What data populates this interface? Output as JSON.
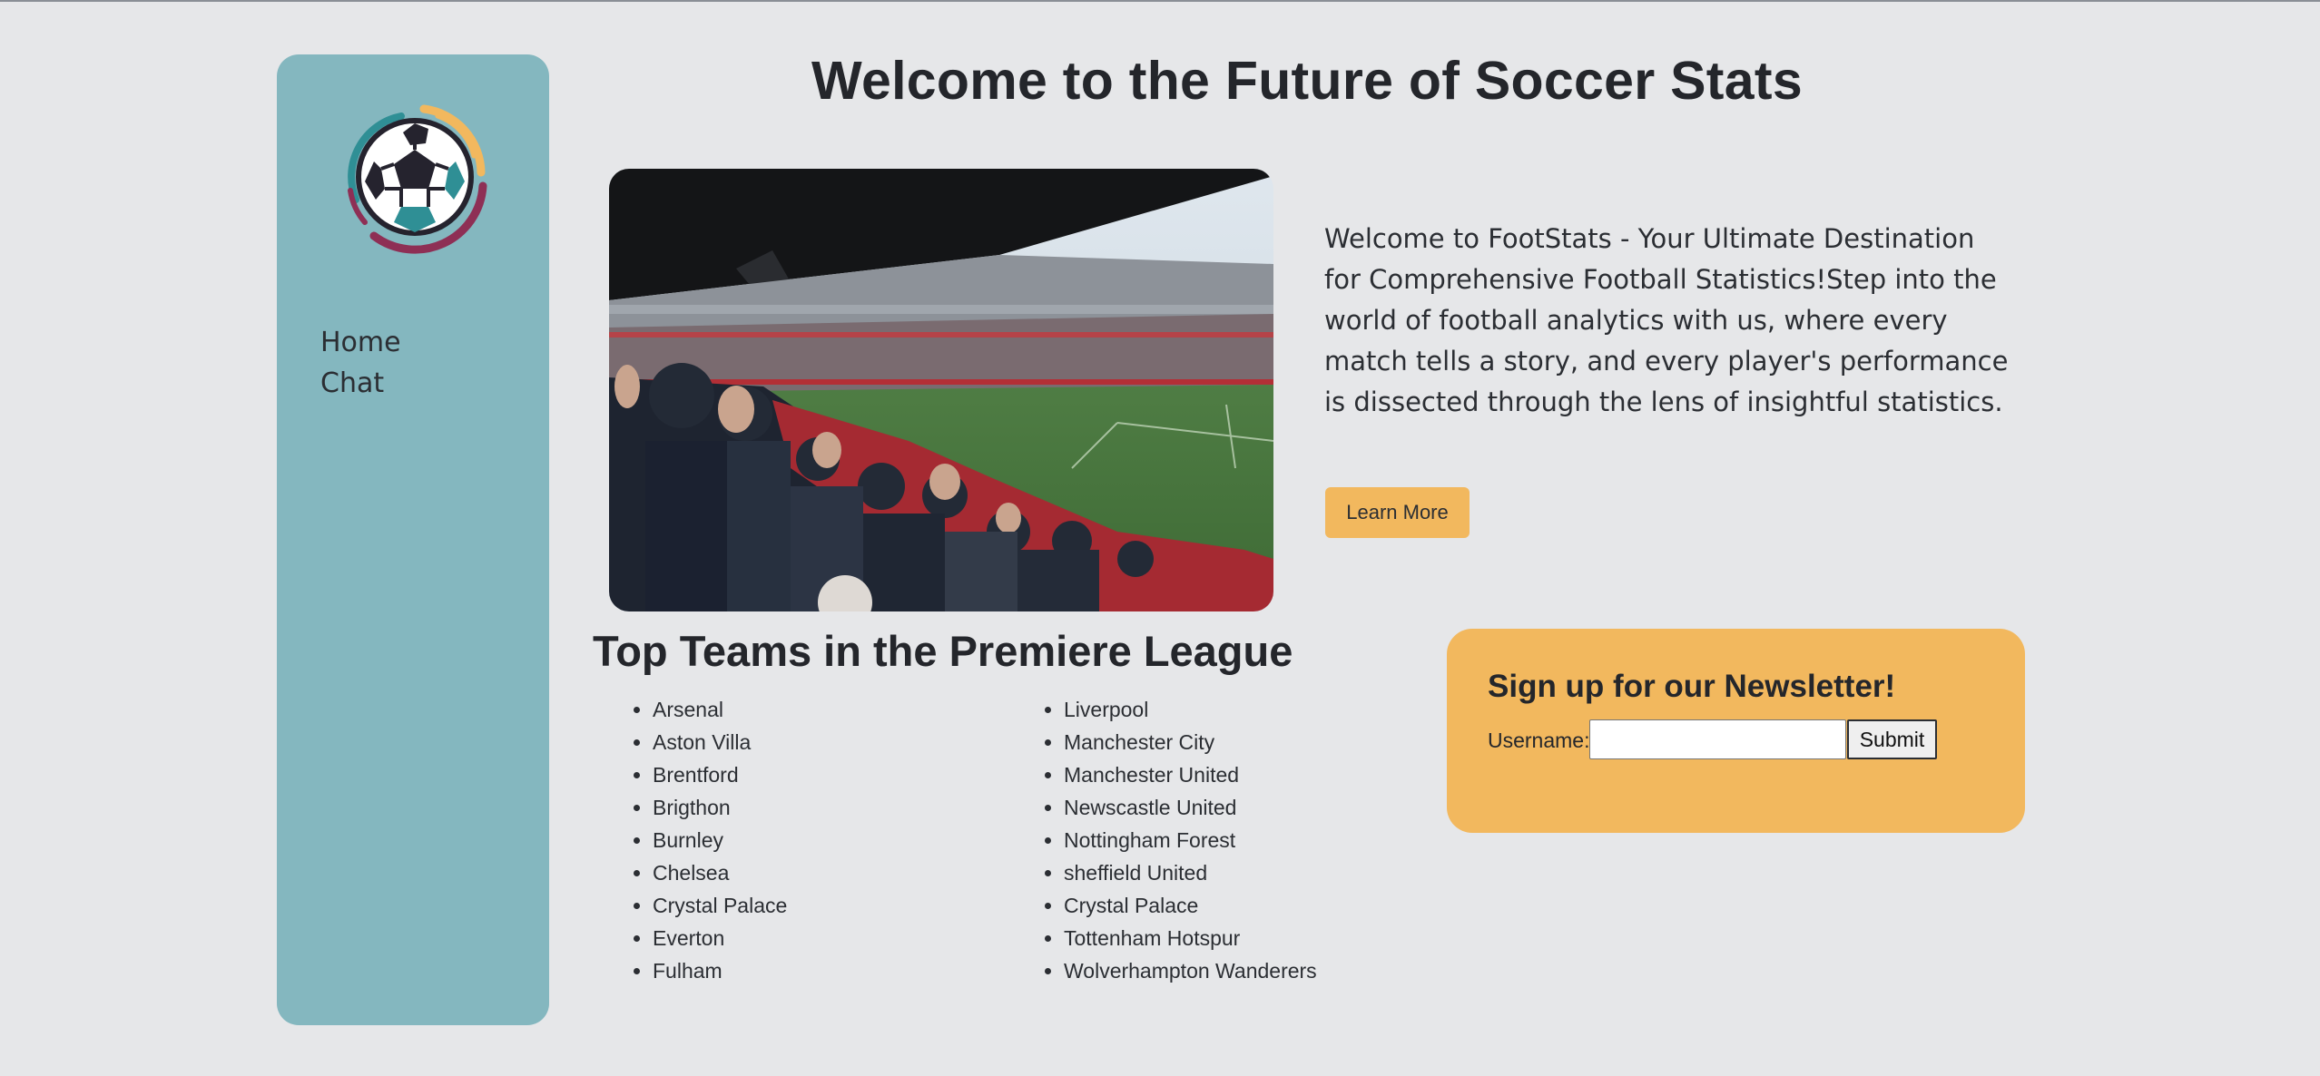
{
  "app": {
    "title": "Welcome to the Future of Soccer Stats",
    "accent_color": "#84b7bf",
    "highlight_color": "#f2b85e",
    "background_color": "#e6e7e9"
  },
  "sidebar": {
    "logo_icon": "soccer-ball-icon",
    "items": [
      {
        "label": "Home"
      },
      {
        "label": "Chat"
      }
    ]
  },
  "hero": {
    "image": "stadium-crowd-photo",
    "text": "Welcome to FootStats - Your Ultimate Destination for Comprehensive Football Statistics!Step into the world of football analytics with us, where every match tells a story, and every player's performance is dissected through the lens of insightful statistics.",
    "button_label": "Learn More"
  },
  "teams": {
    "title": "Top Teams in the Premiere League",
    "column1": [
      "Arsenal",
      "Aston Villa",
      "Brentford",
      "Brigthon",
      "Burnley",
      "Chelsea",
      "Crystal Palace",
      "Everton",
      "Fulham"
    ],
    "column2": [
      "Liverpool",
      "Manchester City",
      "Manchester United",
      "Newscastle United",
      "Nottingham Forest",
      "sheffield United",
      "Crystal Palace",
      "Tottenham Hotspur",
      "Wolverhampton Wanderers"
    ]
  },
  "newsletter": {
    "title": "Sign up for our Newsletter!",
    "username_label": "Username:",
    "username_value": "",
    "submit_label": "Submit"
  }
}
